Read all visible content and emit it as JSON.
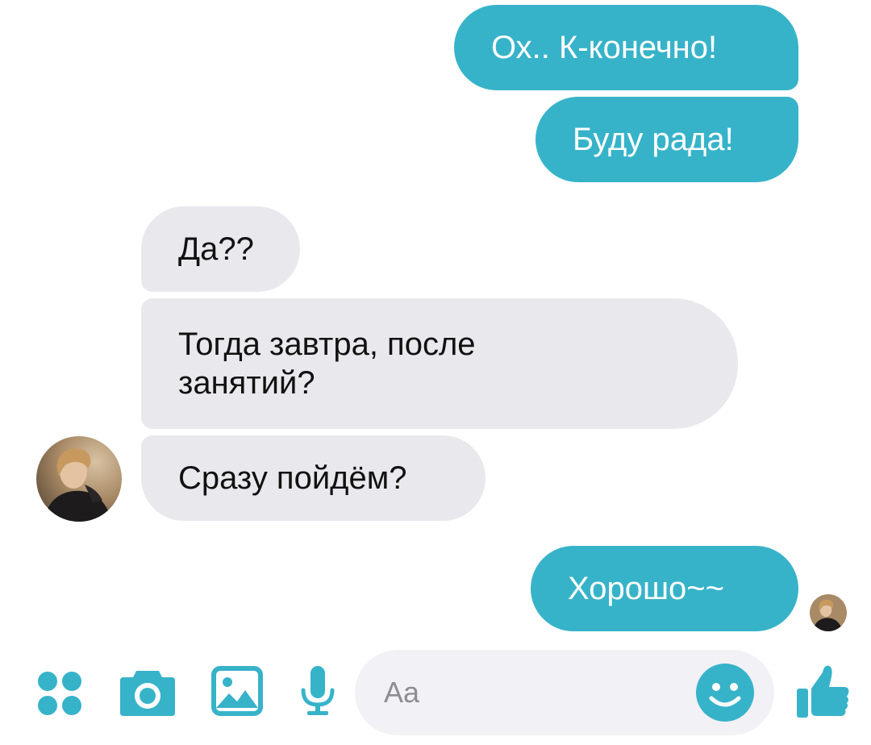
{
  "messages": [
    {
      "text": "Ох.. К-конечно!",
      "direction": "outgoing"
    },
    {
      "text": "Буду рада!",
      "direction": "outgoing"
    },
    {
      "text": "Да??",
      "direction": "incoming"
    },
    {
      "text": "Тогда завтра, после\nзанятий?",
      "direction": "incoming"
    },
    {
      "text": "Сразу пойдём?",
      "direction": "incoming"
    },
    {
      "text": "Хорошо~~",
      "direction": "outgoing"
    }
  ],
  "composer": {
    "placeholder": "Aa"
  },
  "icons": {
    "menu": "four-dots-icon",
    "camera": "camera-icon",
    "gallery": "image-icon",
    "voice": "microphone-icon",
    "emoji": "smiley-icon",
    "like": "thumbs-up-icon"
  },
  "colors": {
    "accent": "#37b3c9",
    "incoming_bubble": "#e9e8ec",
    "composer_bg": "#f2f1f5"
  }
}
